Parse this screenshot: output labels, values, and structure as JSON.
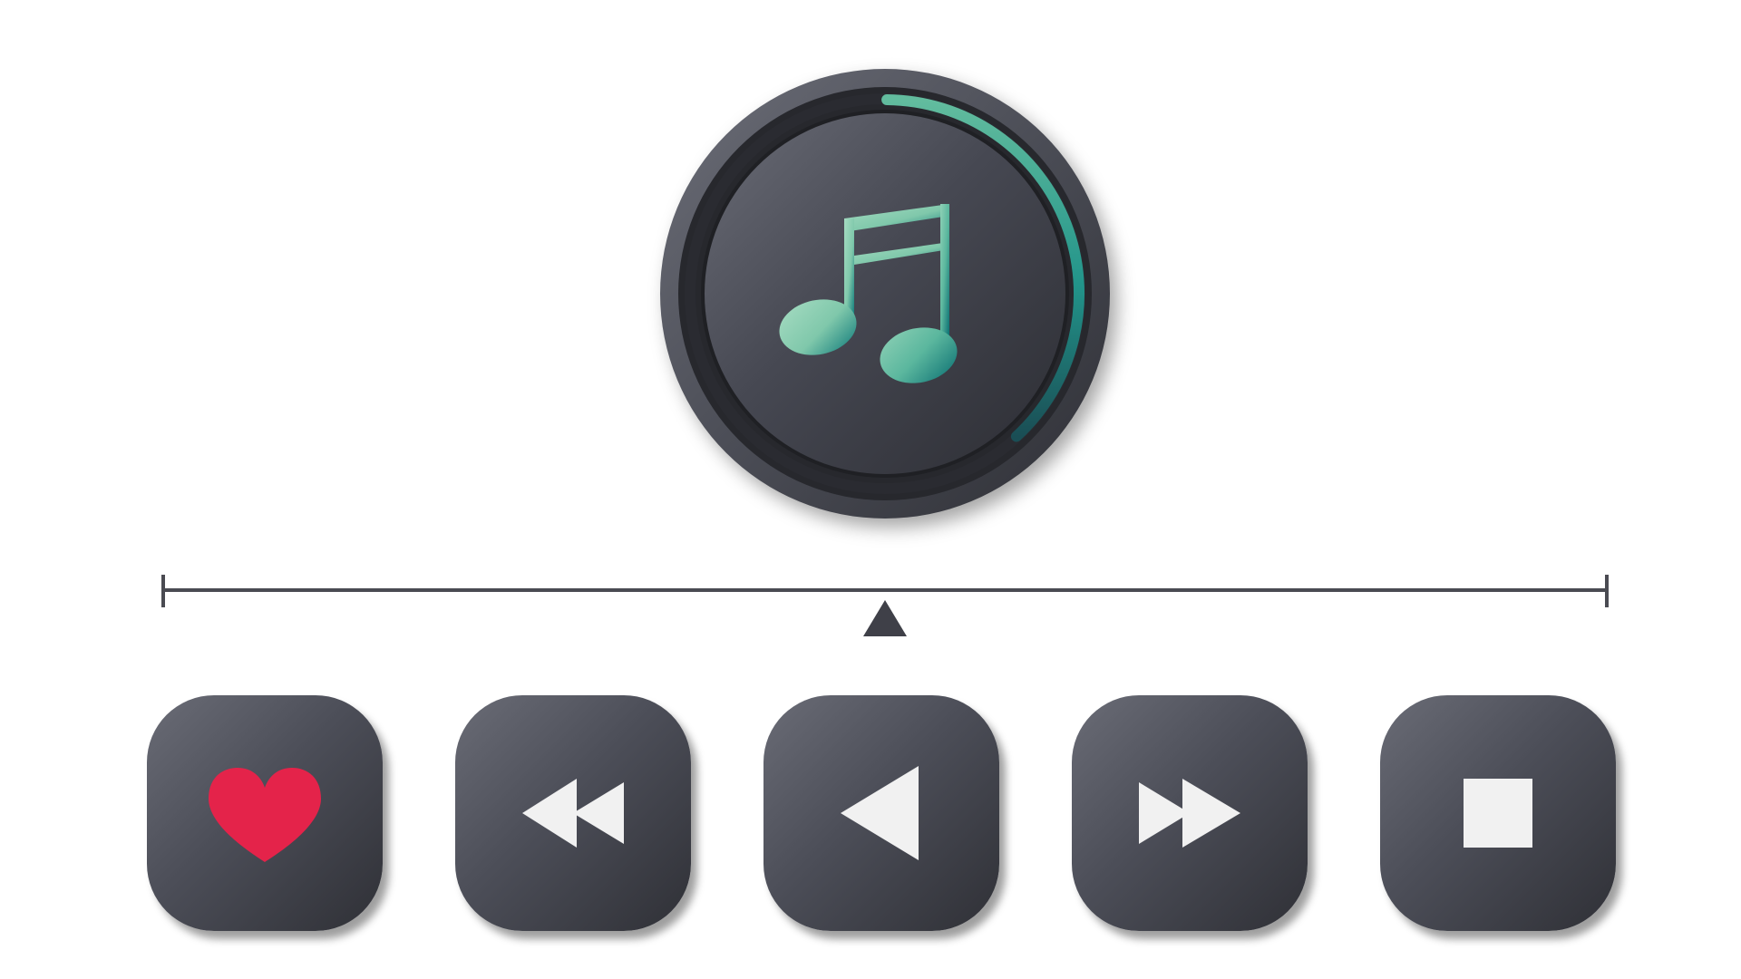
{
  "player": {
    "progress": 0.38,
    "knob_icon": "music-note-icon",
    "playhead_position": 0.5
  },
  "controls": [
    {
      "id": "favorite",
      "icon": "heart-icon"
    },
    {
      "id": "rewind",
      "icon": "rewind-icon"
    },
    {
      "id": "play",
      "icon": "play-reverse-icon"
    },
    {
      "id": "fast-forward",
      "icon": "fast-forward-icon"
    },
    {
      "id": "stop",
      "icon": "stop-icon"
    }
  ],
  "colors": {
    "button_dark": "#3a3c44",
    "button_light": "#6a6c76",
    "accent_teal": "#19837f",
    "accent_mint": "#9fd8bd",
    "heart_red": "#e4234a",
    "icon_white": "#f1f1f1",
    "timeline": "#4a4b52"
  }
}
